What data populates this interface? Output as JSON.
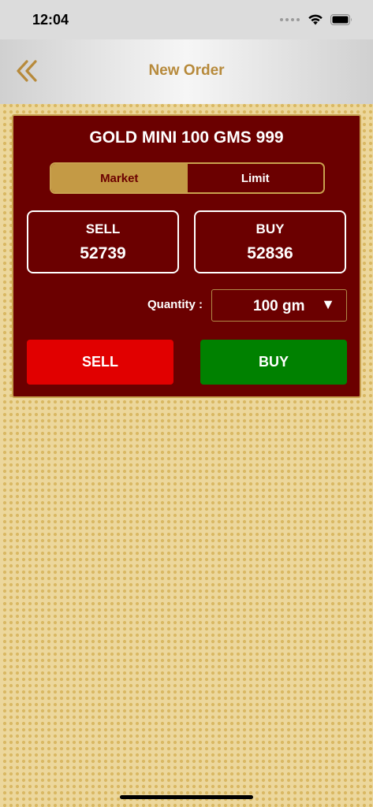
{
  "status_bar": {
    "time": "12:04",
    "icons": [
      "signal-dots-icon",
      "wifi-icon",
      "battery-icon"
    ]
  },
  "header": {
    "back_icon": "double-chevron-left-icon",
    "title": "New Order"
  },
  "order": {
    "product_name": "GOLD MINI 100 GMS 999",
    "order_type_tabs": [
      {
        "label": "Market",
        "active": true
      },
      {
        "label": "Limit",
        "active": false
      }
    ],
    "sell_quote": {
      "label": "SELL",
      "price": "52739"
    },
    "buy_quote": {
      "label": "BUY",
      "price": "52836"
    },
    "quantity": {
      "label": "Quantity :",
      "selected": "100 gm",
      "arrow": "▼"
    },
    "sell_button_label": "SELL",
    "buy_button_label": "BUY"
  },
  "colors": {
    "card_background": "#6b0000",
    "gold_accent": "#c49a45",
    "header_title": "#b78a3b",
    "sell_red": "#e10000",
    "buy_green": "#008100",
    "page_background": "#ecd79c"
  }
}
